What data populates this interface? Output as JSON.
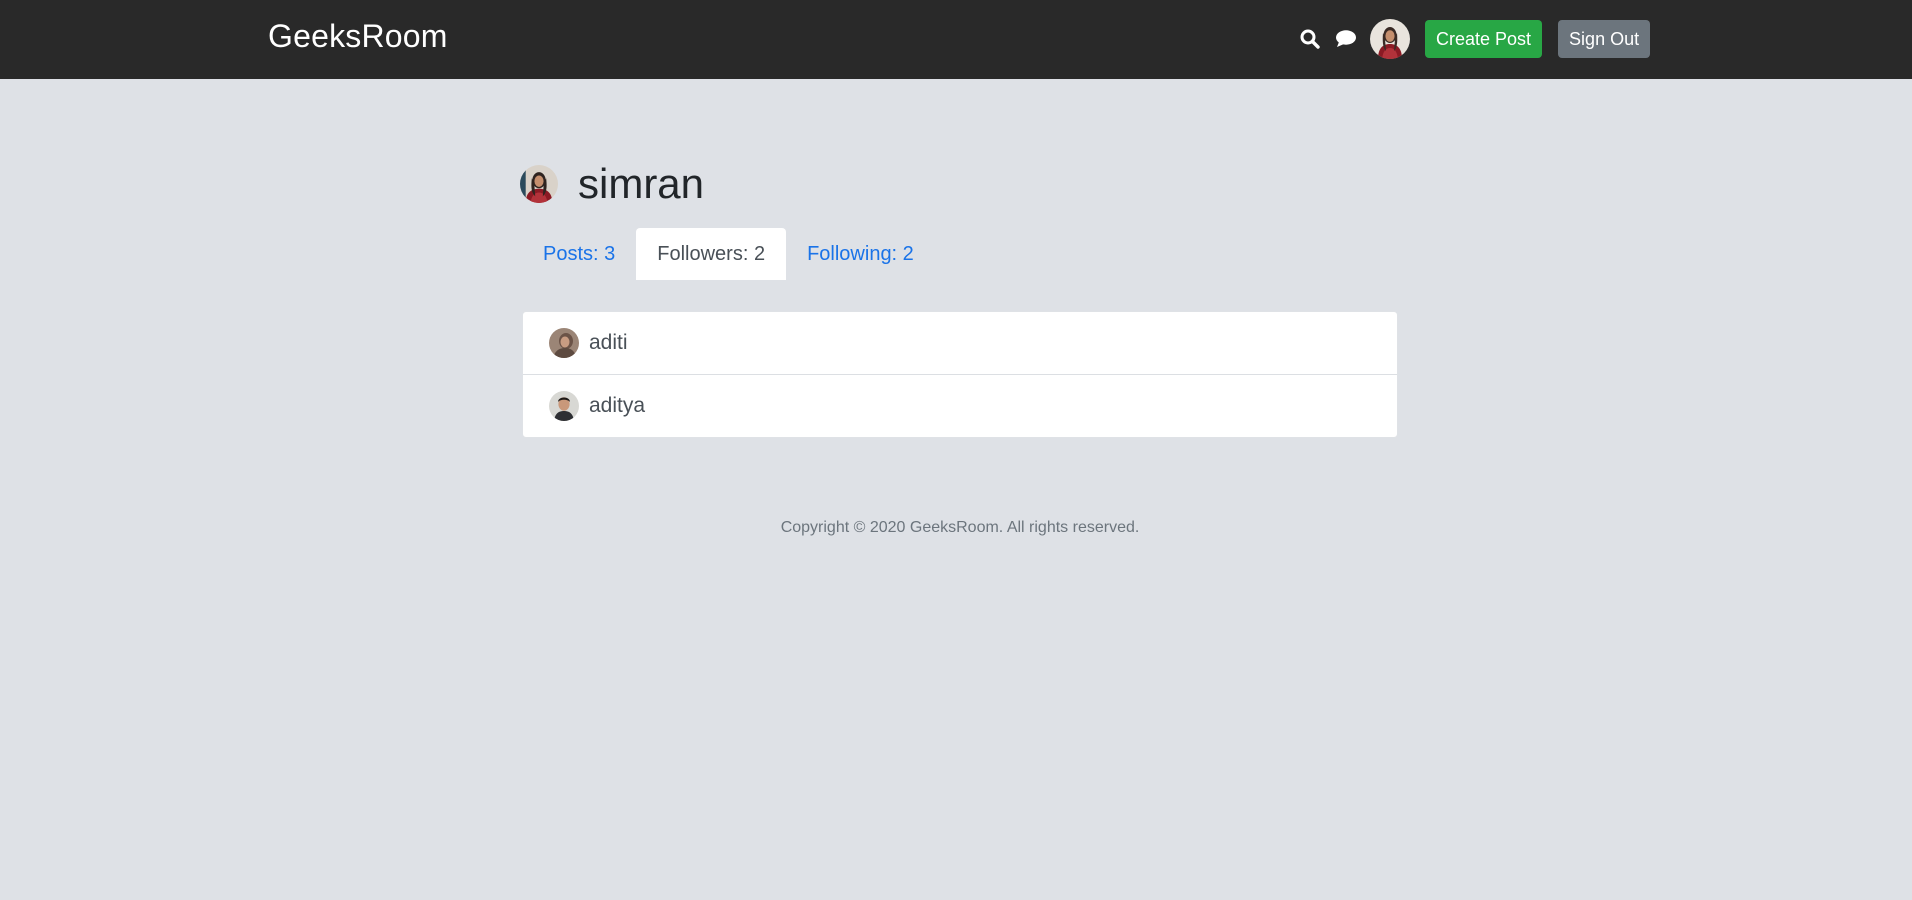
{
  "navbar": {
    "brand": "GeeksRoom",
    "icons": [
      "search-icon",
      "chat-bubble-icon"
    ],
    "create_post_label": "Create Post",
    "sign_out_label": "Sign Out",
    "colors": {
      "background": "#292929",
      "create_button": "#28a745",
      "sign_out_button": "#6c757d"
    }
  },
  "profile": {
    "username": "simran",
    "tabs": [
      {
        "label": "Posts: 3",
        "active": false
      },
      {
        "label": "Followers: 2",
        "active": true
      },
      {
        "label": "Following: 2",
        "active": false
      }
    ]
  },
  "followers": [
    {
      "name": "aditi"
    },
    {
      "name": "aditya"
    }
  ],
  "footer": {
    "text": "Copyright © 2020 GeeksRoom. All rights reserved."
  },
  "colors": {
    "page_background": "#dee1e6",
    "link": "#1a73e8"
  }
}
